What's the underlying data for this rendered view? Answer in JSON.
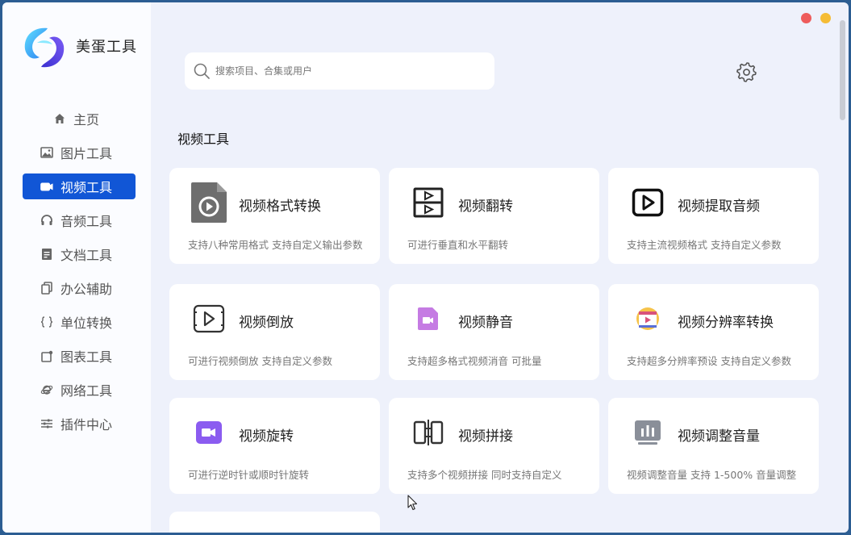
{
  "app": {
    "name": "美蛋工具"
  },
  "sidebar": {
    "items": [
      {
        "label": "主页",
        "icon": "home-icon",
        "active": false
      },
      {
        "label": "图片工具",
        "icon": "image-icon",
        "active": false
      },
      {
        "label": "视频工具",
        "icon": "video-icon",
        "active": true
      },
      {
        "label": "音频工具",
        "icon": "headphones-icon",
        "active": false
      },
      {
        "label": "文档工具",
        "icon": "document-icon",
        "active": false
      },
      {
        "label": "办公辅助",
        "icon": "copy-icon",
        "active": false
      },
      {
        "label": "单位转换",
        "icon": "braces-icon",
        "active": false
      },
      {
        "label": "图表工具",
        "icon": "chart-icon",
        "active": false
      },
      {
        "label": "网络工具",
        "icon": "ie-icon",
        "active": false
      },
      {
        "label": "插件中心",
        "icon": "sliders-icon",
        "active": false
      }
    ]
  },
  "search": {
    "placeholder": "搜索项目、合集或用户"
  },
  "section": {
    "title": "视频工具"
  },
  "cards": [
    {
      "title": "视频格式转换",
      "desc": "支持八种常用格式 支持自定义输出参数",
      "icon": "video-file-icon"
    },
    {
      "title": "视频翻转",
      "desc": "可进行垂直和水平翻转",
      "icon": "flip-icon"
    },
    {
      "title": "视频提取音频",
      "desc": "支持主流视频格式 支持自定义参数",
      "icon": "play-box-icon"
    },
    {
      "title": "视频倒放",
      "desc": "可进行视频倒放 支持自定义参数",
      "icon": "reverse-play-icon"
    },
    {
      "title": "视频静音",
      "desc": "支持超多格式视频消音 可批量",
      "icon": "mute-video-icon"
    },
    {
      "title": "视频分辨率转换",
      "desc": "支持超多分辨率预设 支持自定义参数",
      "icon": "resolution-icon"
    },
    {
      "title": "视频旋转",
      "desc": "可进行逆时针或顺时针旋转",
      "icon": "rotate-video-icon"
    },
    {
      "title": "视频拼接",
      "desc": "支持多个视频拼接 同时支持自定义",
      "icon": "splice-icon"
    },
    {
      "title": "视频调整音量",
      "desc": "视频调整音量 支持 1-500% 音量调整",
      "icon": "volume-bars-icon"
    }
  ],
  "colors": {
    "accent": "#1156d6",
    "background": "#eef1fb",
    "sidebar": "#fbfcff"
  }
}
